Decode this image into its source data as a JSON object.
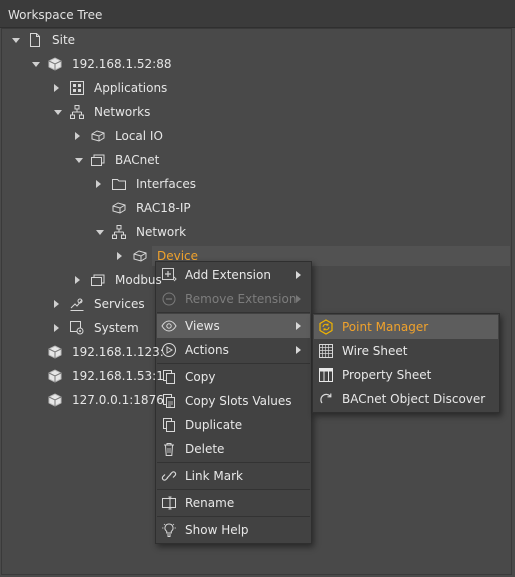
{
  "panel": {
    "title": "Workspace Tree"
  },
  "tree": [
    {
      "label": "Site",
      "expanded": true,
      "icon": "file-icon"
    },
    {
      "label": "192.168.1.52:88",
      "expanded": true,
      "icon": "station-icon"
    },
    {
      "label": "Applications",
      "expanded": false,
      "icon": "applications-icon"
    },
    {
      "label": "Networks",
      "expanded": true,
      "icon": "network-icon"
    },
    {
      "label": "Local IO",
      "expanded": false,
      "icon": "device-icon"
    },
    {
      "label": "BACnet",
      "expanded": true,
      "icon": "bacnet-icon"
    },
    {
      "label": "Interfaces",
      "expanded": false,
      "icon": "folder-icon"
    },
    {
      "label": "RAC18-IP",
      "expanded": null,
      "icon": "device-icon"
    },
    {
      "label": "Network",
      "expanded": true,
      "icon": "network-icon"
    },
    {
      "label": "Device",
      "expanded": false,
      "icon": "device-icon"
    },
    {
      "label": "Modbus",
      "expanded": false,
      "icon": "bacnet-icon"
    },
    {
      "label": "Services",
      "expanded": false,
      "icon": "services-icon"
    },
    {
      "label": "System",
      "expanded": false,
      "icon": "system-icon"
    },
    {
      "label": "192.168.1.123:",
      "expanded": null,
      "icon": "station-icon"
    },
    {
      "label": "192.168.1.53:1",
      "expanded": null,
      "icon": "station-icon"
    },
    {
      "label": "127.0.0.1:1876",
      "expanded": null,
      "icon": "station-icon"
    }
  ],
  "context_menu": {
    "items": [
      {
        "label": "Add Extension",
        "icon": "add-extension-icon",
        "submenu": true,
        "disabled": false
      },
      {
        "label": "Remove Extension",
        "icon": "remove-extension-icon",
        "submenu": true,
        "disabled": true
      },
      {
        "label": "Views",
        "icon": "eye-icon",
        "submenu": true,
        "disabled": false,
        "highlighted": true
      },
      {
        "label": "Actions",
        "icon": "play-icon",
        "submenu": true,
        "disabled": false
      },
      {
        "label": "Copy",
        "icon": "copy-icon",
        "submenu": false,
        "disabled": false
      },
      {
        "label": "Copy Slots Values",
        "icon": "copy-slots-icon",
        "submenu": false,
        "disabled": false
      },
      {
        "label": "Duplicate",
        "icon": "duplicate-icon",
        "submenu": false,
        "disabled": false
      },
      {
        "label": "Delete",
        "icon": "trash-icon",
        "submenu": false,
        "disabled": false
      },
      {
        "label": "Link Mark",
        "icon": "link-icon",
        "submenu": false,
        "disabled": false
      },
      {
        "label": "Rename",
        "icon": "rename-icon",
        "submenu": false,
        "disabled": false
      },
      {
        "label": "Show Help",
        "icon": "lightbulb-icon",
        "submenu": false,
        "disabled": false
      }
    ]
  },
  "views_submenu": {
    "items": [
      {
        "label": "Point Manager",
        "icon": "point-manager-icon",
        "highlighted": true
      },
      {
        "label": "Wire Sheet",
        "icon": "grid-icon"
      },
      {
        "label": "Property Sheet",
        "icon": "table-icon"
      },
      {
        "label": "BACnet Object Discover",
        "icon": "refresh-icon"
      }
    ]
  },
  "colors": {
    "selected_text": "#f0a22c",
    "background": "#494949",
    "menu_bg": "#424242",
    "highlight": "#5d5d5d"
  }
}
